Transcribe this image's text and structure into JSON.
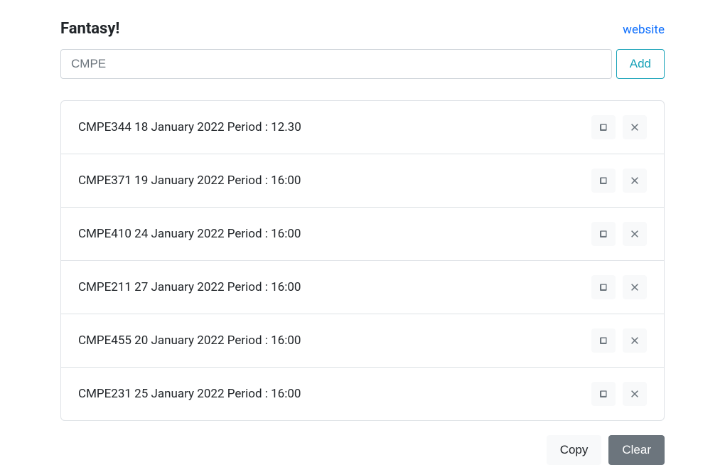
{
  "header": {
    "title": "Fantasy!",
    "link": "website"
  },
  "input": {
    "value": "CMPE",
    "add_label": "Add"
  },
  "items": [
    {
      "text": "CMPE344  18 January 2022 Period : 12.30"
    },
    {
      "text": "CMPE371  19 January 2022 Period : 16:00"
    },
    {
      "text": "CMPE410  24 January 2022 Period : 16:00"
    },
    {
      "text": "CMPE211  27 January 2022 Period : 16:00"
    },
    {
      "text": "CMPE455  20 January 2022 Period : 16:00"
    },
    {
      "text": "CMPE231  25 January 2022 Period : 16:00"
    }
  ],
  "footer": {
    "copy": "Copy",
    "clear": "Clear"
  }
}
